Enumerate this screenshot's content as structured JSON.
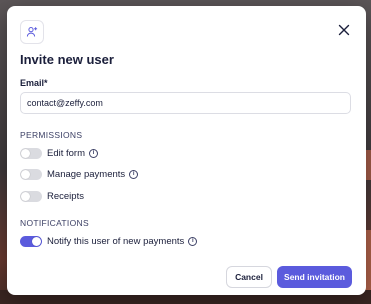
{
  "modal": {
    "title": "Invite new user",
    "email": {
      "label": "Email*",
      "value": "contact@zeffy.com"
    },
    "permissions": {
      "heading": "PERMISSIONS",
      "items": [
        {
          "label": "Edit form",
          "enabled": false,
          "has_info": true
        },
        {
          "label": "Manage payments",
          "enabled": false,
          "has_info": true
        },
        {
          "label": "Receipts",
          "enabled": false,
          "has_info": false
        }
      ]
    },
    "notifications": {
      "heading": "NOTIFICATIONS",
      "items": [
        {
          "label": "Notify this user of new payments",
          "enabled": true,
          "has_info": true
        }
      ]
    },
    "buttons": {
      "cancel": "Cancel",
      "send": "Send invitation"
    }
  },
  "icons": {
    "header": "user-plus-icon",
    "close": "close-icon",
    "info": "info-icon"
  },
  "colors": {
    "accent": "#5b5bdd",
    "text": "#1b1f3b",
    "toggle_off": "#dadbe0"
  }
}
